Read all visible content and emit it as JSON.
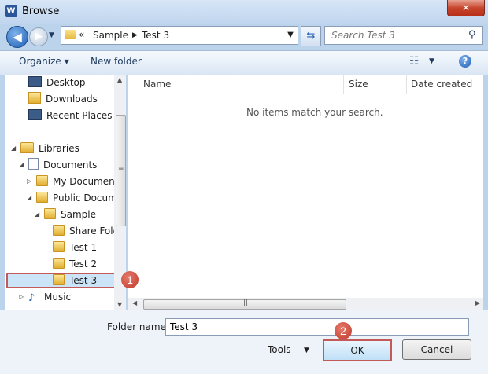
{
  "window": {
    "title": "Browse",
    "app_icon": "W",
    "close": "✕"
  },
  "nav": {
    "back": "◀",
    "forward": "▶",
    "address": {
      "chevron": "«",
      "crumbs": [
        "Sample",
        "Test 3"
      ],
      "separator": "▶"
    },
    "search_placeholder": "Search Test 3"
  },
  "toolbar": {
    "organize": "Organize ▾",
    "new_folder": "New folder"
  },
  "navpane": {
    "items": [
      {
        "label": "Desktop"
      },
      {
        "label": "Downloads"
      },
      {
        "label": "Recent Places"
      },
      {
        "label": "Libraries"
      },
      {
        "label": "Documents"
      },
      {
        "label": "My Document"
      },
      {
        "label": "Public Docume"
      },
      {
        "label": "Sample"
      },
      {
        "label": "Share Folde"
      },
      {
        "label": "Test 1"
      },
      {
        "label": "Test 2"
      },
      {
        "label": "Test 3",
        "selected": true
      },
      {
        "label": "Music"
      }
    ]
  },
  "filepane": {
    "columns": [
      "Name",
      "Size",
      "Date created"
    ],
    "empty_message": "No items match your search."
  },
  "footer": {
    "folder_name_label": "Folder name:",
    "folder_name_value": "Test 3",
    "tools": "Tools",
    "ok": "OK",
    "cancel": "Cancel"
  },
  "annotations": [
    "1",
    "2"
  ],
  "colors": {
    "accent": "#c35a5a",
    "selection": "#cce4f7"
  }
}
